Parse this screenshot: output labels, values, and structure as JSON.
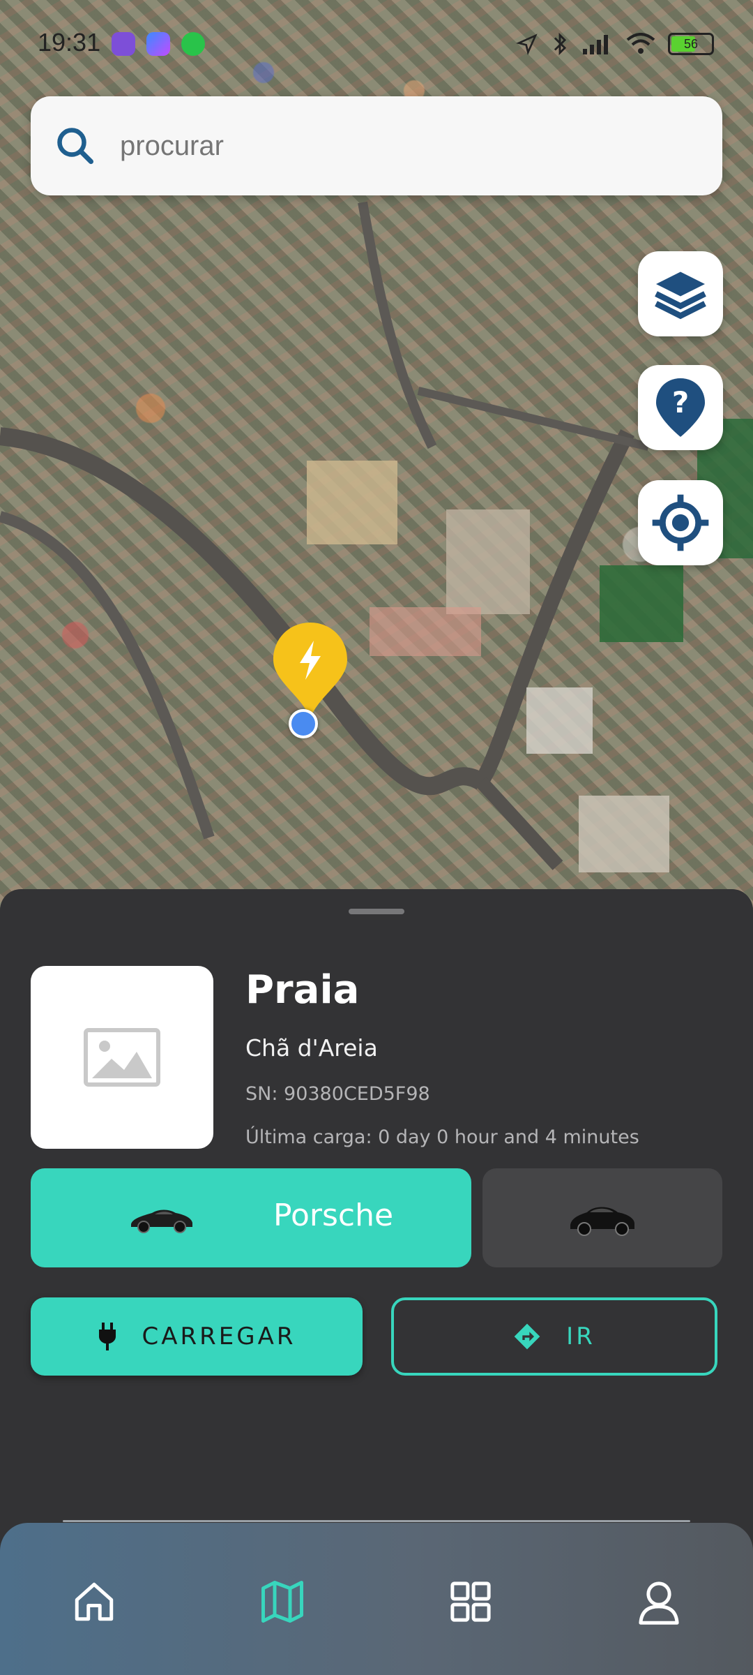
{
  "status_bar": {
    "time": "19:31",
    "battery": "56"
  },
  "search": {
    "placeholder": "procurar",
    "icon": "search-icon"
  },
  "map_controls": [
    {
      "icon": "layers-icon"
    },
    {
      "icon": "help-marker-icon"
    },
    {
      "icon": "locate-crosshair-icon"
    }
  ],
  "station": {
    "title": "Praia",
    "subtitle": "Chã d'Areia",
    "serial": "SN: 90380CED5F98",
    "last_charge": "Última carga: 0 day 0 hour and 4 minutes"
  },
  "vehicles": [
    {
      "name": "Porsche",
      "selected": true
    },
    {
      "name": "",
      "selected": false
    }
  ],
  "actions": {
    "charge_label": "CARREGAR",
    "go_label": "IR"
  },
  "nav": [
    {
      "icon": "home-icon",
      "active": false
    },
    {
      "icon": "map-icon",
      "active": true
    },
    {
      "icon": "grid-icon",
      "active": false
    },
    {
      "icon": "user-icon",
      "active": false
    }
  ],
  "colors": {
    "accent": "#38d6bd",
    "sheet": "#333335",
    "marker": "#f6c21a",
    "search_text": "#1b3f63",
    "icon_blue": "#1f4f7f"
  }
}
